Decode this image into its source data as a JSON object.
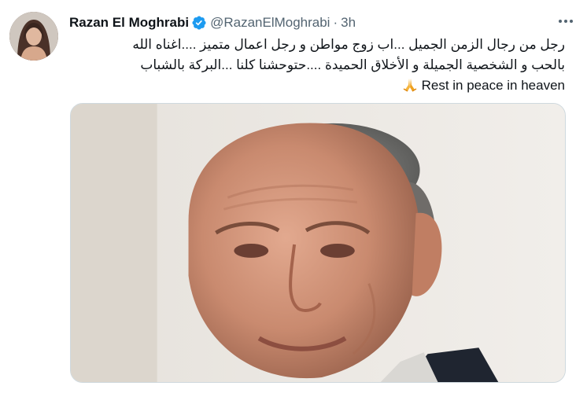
{
  "tweet": {
    "author": {
      "display_name": "Razan El Moghrabi",
      "handle": "@RazanElMoghrabi",
      "separator": "·",
      "time": "3h",
      "verified": true,
      "verified_color": "#1d9bf0",
      "avatar_icon": "profile-photo"
    },
    "more_icon": "more-horizontal-icon",
    "text": {
      "line1": "رجل من رجال الزمن الجميل ...اب زوج مواطن و رجل اعمال متميز ....اغناه الله",
      "line2": "بالحب و الشخصية الجميلة و الأخلاق الحميدة ....حتوحشنا كلنا ...البركة بالشباب",
      "line3": "Rest in peace in heaven",
      "line3_emoji": "folded-hands-emoji"
    },
    "media": {
      "type": "photo",
      "subject_icon": "portrait-elderly-man"
    }
  }
}
